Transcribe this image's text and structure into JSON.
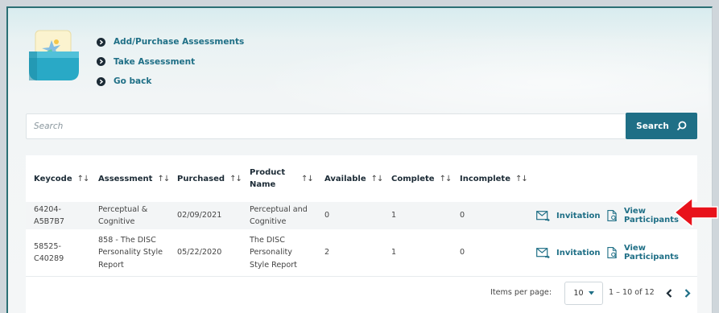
{
  "nav_links": [
    {
      "label": "Add/Purchase Assessments"
    },
    {
      "label": "Take Assessment"
    },
    {
      "label": "Go back"
    }
  ],
  "search": {
    "placeholder": "Search",
    "button_label": "Search"
  },
  "table": {
    "columns": [
      {
        "label": "Keycode"
      },
      {
        "label": "Assessment"
      },
      {
        "label": "Purchased"
      },
      {
        "label": "Product Name"
      },
      {
        "label": "Available"
      },
      {
        "label": "Complete"
      },
      {
        "label": "Incomplete"
      }
    ],
    "rows": [
      {
        "keycode": "64204-A5B7B7",
        "assessment": "Perceptual & Cognitive",
        "purchased": "02/09/2021",
        "product_name": "Perceptual and Cognitive",
        "available": "0",
        "complete": "1",
        "incomplete": "0",
        "invitation_label": "Invitation",
        "participants_label": "View Participants"
      },
      {
        "keycode": "58525-C40289",
        "assessment": "858 - The DISC Personality Style Report",
        "purchased": "05/22/2020",
        "product_name": "The DISC Personality Style Report",
        "available": "2",
        "complete": "1",
        "incomplete": "0",
        "invitation_label": "Invitation",
        "participants_label": "View Participants"
      }
    ]
  },
  "paginator": {
    "items_per_page_label": "Items per page:",
    "page_size": "10",
    "range_label": "1 – 10 of 12"
  },
  "icons": {
    "nav_bullet": "chevron-right-circle-icon",
    "search": "search-icon",
    "invitation": "envelope-icon",
    "participants": "document-search-icon",
    "sort": "sort-icon",
    "pointer": "red-arrow-icon"
  },
  "colors": {
    "accent": "#1f6f86",
    "pointer_arrow": "#e8121b",
    "bullet": "#1c2b36"
  }
}
